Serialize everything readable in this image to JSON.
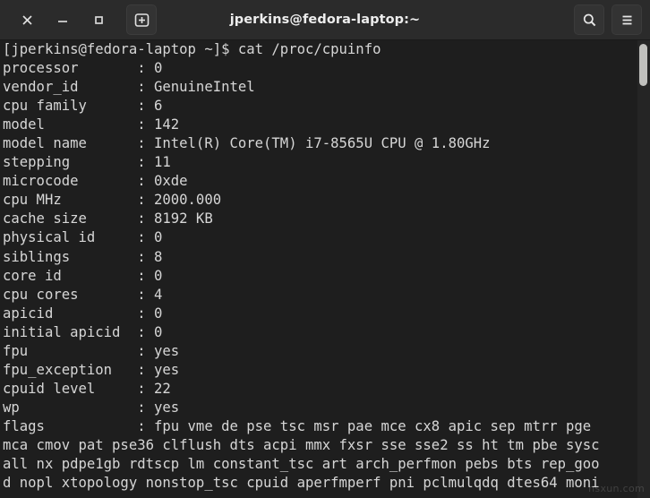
{
  "window": {
    "title": "jperkins@fedora-laptop:~"
  },
  "titlebar": {
    "close_label": "✕",
    "minimize_label": "—",
    "maximize_label": "□",
    "new_tab_label": "+",
    "search_label": "search",
    "menu_label": "menu"
  },
  "terminal": {
    "prompt_line": "[jperkins@fedora-laptop ~]$ cat /proc/cpuinfo",
    "lines": [
      "[jperkins@fedora-laptop ~]$ cat /proc/cpuinfo",
      "processor       : 0",
      "vendor_id       : GenuineIntel",
      "cpu family      : 6",
      "model           : 142",
      "model name      : Intel(R) Core(TM) i7-8565U CPU @ 1.80GHz",
      "stepping        : 11",
      "microcode       : 0xde",
      "cpu MHz         : 2000.000",
      "cache size      : 8192 KB",
      "physical id     : 0",
      "siblings        : 8",
      "core id         : 0",
      "cpu cores       : 4",
      "apicid          : 0",
      "initial apicid  : 0",
      "fpu             : yes",
      "fpu_exception   : yes",
      "cpuid level     : 22",
      "wp              : yes",
      "flags           : fpu vme de pse tsc msr pae mce cx8 apic sep mtrr pge",
      "mca cmov pat pse36 clflush dts acpi mmx fxsr sse sse2 ss ht tm pbe sysc",
      "all nx pdpe1gb rdtscp lm constant_tsc art arch_perfmon pebs bts rep_goo",
      "d nopl xtopology nonstop_tsc cpuid aperfmperf pni pclmulqdq dtes64 moni"
    ],
    "fields": [
      {
        "key": "processor",
        "value": "0"
      },
      {
        "key": "vendor_id",
        "value": "GenuineIntel"
      },
      {
        "key": "cpu family",
        "value": "6"
      },
      {
        "key": "model",
        "value": "142"
      },
      {
        "key": "model name",
        "value": "Intel(R) Core(TM) i7-8565U CPU @ 1.80GHz"
      },
      {
        "key": "stepping",
        "value": "11"
      },
      {
        "key": "microcode",
        "value": "0xde"
      },
      {
        "key": "cpu MHz",
        "value": "2000.000"
      },
      {
        "key": "cache size",
        "value": "8192 KB"
      },
      {
        "key": "physical id",
        "value": "0"
      },
      {
        "key": "siblings",
        "value": "8"
      },
      {
        "key": "core id",
        "value": "0"
      },
      {
        "key": "cpu cores",
        "value": "4"
      },
      {
        "key": "apicid",
        "value": "0"
      },
      {
        "key": "initial apicid",
        "value": "0"
      },
      {
        "key": "fpu",
        "value": "yes"
      },
      {
        "key": "fpu_exception",
        "value": "yes"
      },
      {
        "key": "cpuid level",
        "value": "22"
      },
      {
        "key": "wp",
        "value": "yes"
      },
      {
        "key": "flags",
        "value": "fpu vme de pse tsc msr pae mce cx8 apic sep mtrr pge mca cmov pat pse36 clflush dts acpi mmx fxsr sse sse2 ss ht tm pbe syscall nx pdpe1gb rdtscp lm constant_tsc art arch_perfmon pebs bts rep_good nopl xtopology nonstop_tsc cpuid aperfmperf pni pclmulqdq dtes64 moni"
      }
    ]
  },
  "watermark": {
    "text": "nsxun.com"
  },
  "colors": {
    "titlebar_bg": "#2b2b2b",
    "terminal_bg": "#1e1e1e",
    "terminal_fg": "#d6d6d6",
    "scrollbar_thumb": "#c0c0bd"
  }
}
